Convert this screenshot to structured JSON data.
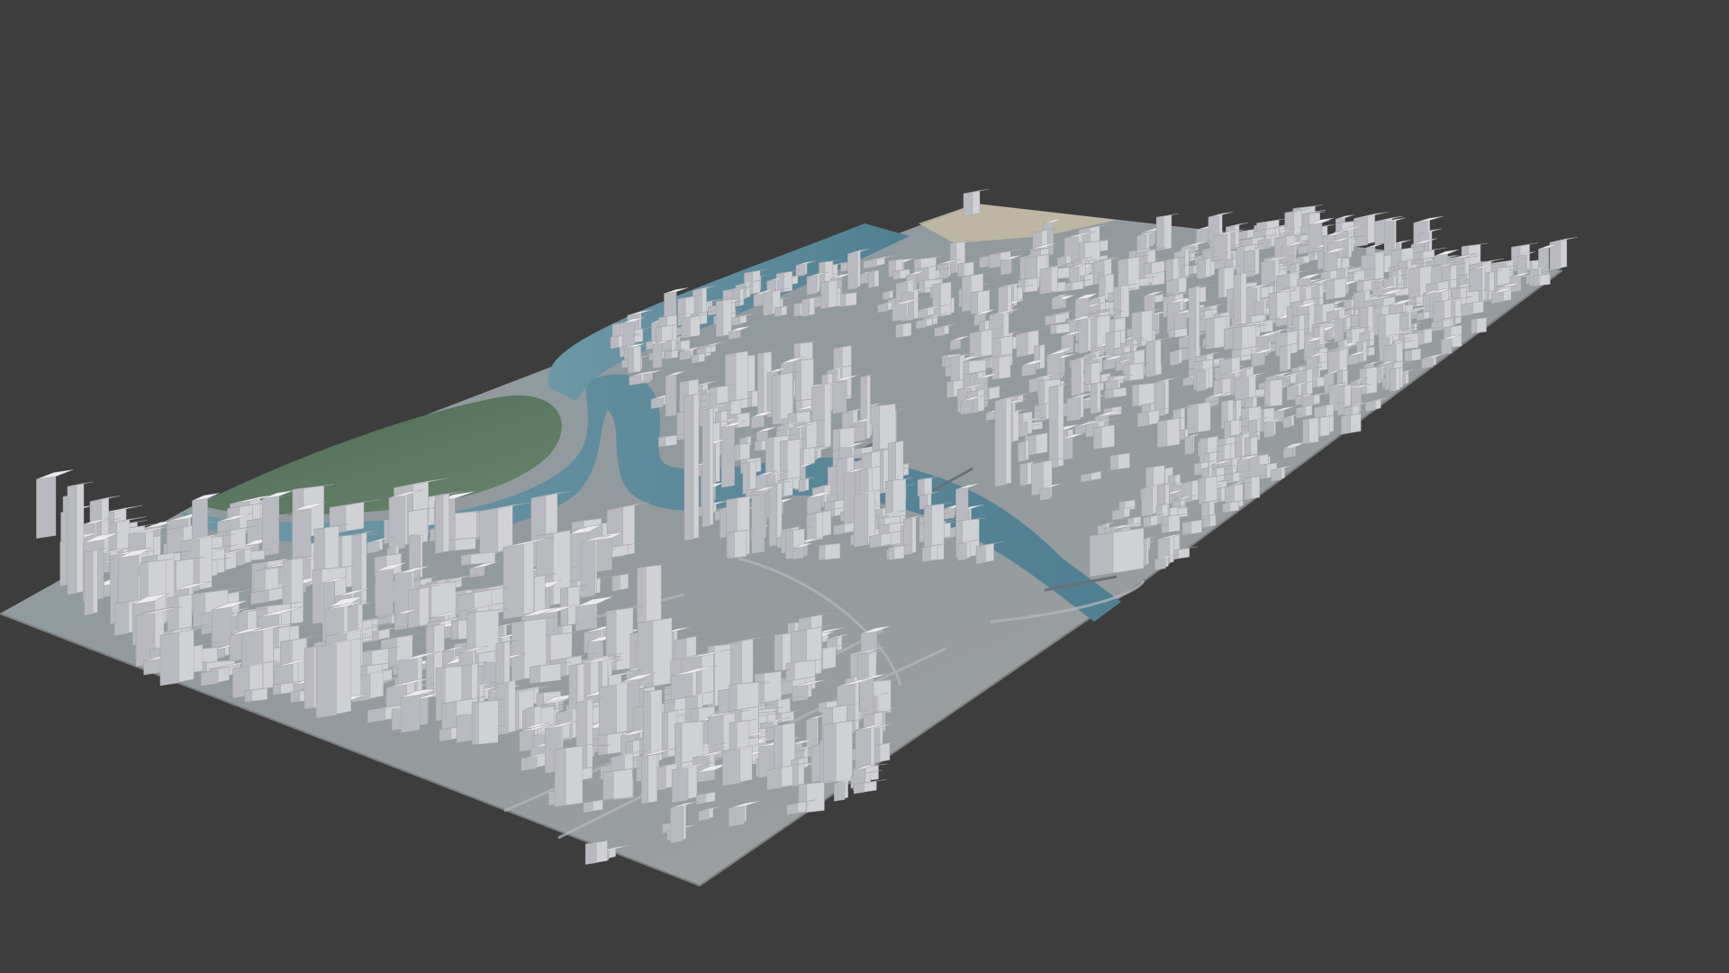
{
  "viewport": {
    "background": "#3d3d3d",
    "scene": "3d-city-model-over-satellite-map",
    "ground_colors": {
      "urban": "#8f979c",
      "vegetation": "#55715a",
      "water": "#5b8a9a",
      "sand": "#c4bba4",
      "road": "#b2b7bd"
    },
    "building_colors": {
      "top": "#ececee",
      "left": "#d0d1d5",
      "right": "#b9babf",
      "edge": "#9fa1a6"
    }
  }
}
